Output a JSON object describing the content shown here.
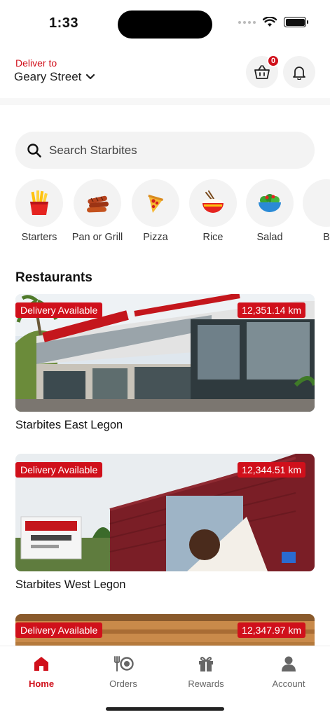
{
  "status": {
    "time": "1:33"
  },
  "header": {
    "deliver_label": "Deliver to",
    "street": "Geary Street",
    "cart_count": "0"
  },
  "search": {
    "placeholder": "Search Starbites"
  },
  "categories": [
    {
      "label": "Starters",
      "icon": "fries-icon"
    },
    {
      "label": "Pan or Grill",
      "icon": "grilled-sausage-icon"
    },
    {
      "label": "Pizza",
      "icon": "pizza-slice-icon"
    },
    {
      "label": "Rice",
      "icon": "rice-bowl-icon"
    },
    {
      "label": "Salad",
      "icon": "salad-bowl-icon"
    },
    {
      "label": "B",
      "icon": "category-icon"
    }
  ],
  "restaurants_title": "Restaurants",
  "restaurants": [
    {
      "name": "Starbites East Legon",
      "delivery": "Delivery Available",
      "distance": "12,351.14 km"
    },
    {
      "name": "Starbites West Legon",
      "delivery": "Delivery Available",
      "distance": "12,344.51 km"
    },
    {
      "name": "",
      "delivery": "Delivery Available",
      "distance": "12,347.97 km"
    }
  ],
  "tabs": [
    {
      "label": "Home",
      "icon": "home-icon",
      "active": true
    },
    {
      "label": "Orders",
      "icon": "plate-cutlery-icon"
    },
    {
      "label": "Rewards",
      "icon": "gift-icon"
    },
    {
      "label": "Account",
      "icon": "user-icon"
    }
  ],
  "colors": {
    "accent": "#d0101b"
  }
}
